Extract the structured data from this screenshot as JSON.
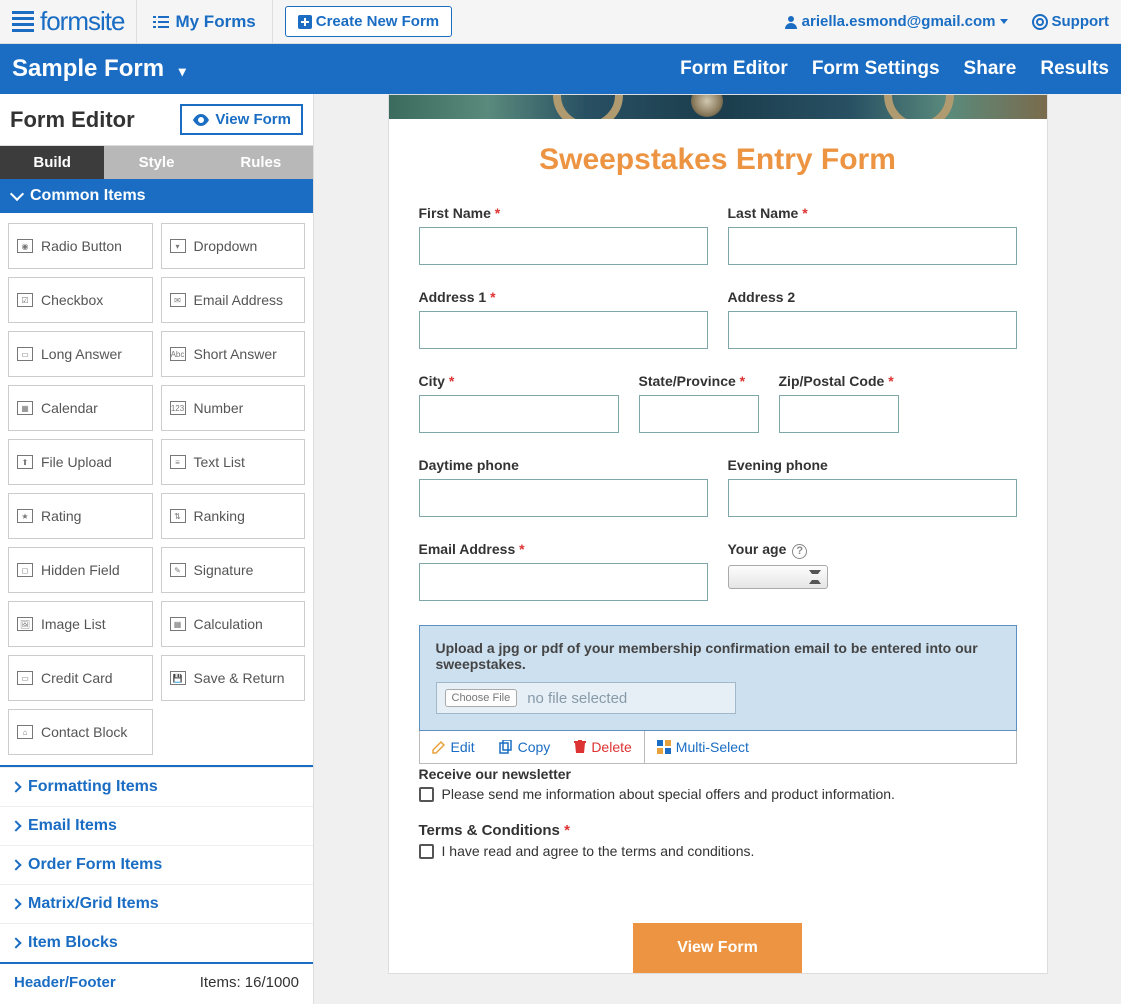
{
  "brand": "formsite",
  "topnav": {
    "my_forms": "My Forms",
    "create": "Create New Form",
    "user": "ariella.esmond@gmail.com",
    "support": "Support"
  },
  "bluebar": {
    "form_name": "Sample Form",
    "tabs": [
      "Form Editor",
      "Form Settings",
      "Share",
      "Results"
    ]
  },
  "sidebar": {
    "title": "Form Editor",
    "view_form": "View Form",
    "bsr": {
      "build": "Build",
      "style": "Style",
      "rules": "Rules"
    },
    "section": "Common Items",
    "items": [
      "Radio Button",
      "Dropdown",
      "Checkbox",
      "Email Address",
      "Long Answer",
      "Short Answer",
      "Calendar",
      "Number",
      "File Upload",
      "Text List",
      "Rating",
      "Ranking",
      "Hidden Field",
      "Signature",
      "Image List",
      "Calculation",
      "Credit Card",
      "Save & Return",
      "Contact Block"
    ],
    "item_icons": [
      "◉",
      "▾",
      "☑",
      "✉",
      "▭",
      "Abc",
      "▦",
      "123",
      "⬆",
      "≡",
      "★",
      "⇅",
      "◻",
      "✎",
      "🖼",
      "▦",
      "▭",
      "💾",
      "⌂"
    ],
    "cats": [
      "Formatting Items",
      "Email Items",
      "Order Form Items",
      "Matrix/Grid Items",
      "Item Blocks"
    ],
    "footer": {
      "hf": "Header/Footer",
      "count": "Items: 16/1000"
    }
  },
  "form": {
    "heading": "Sweepstakes Entry Form",
    "fields": {
      "first_name": "First Name",
      "last_name": "Last Name",
      "address1": "Address 1",
      "address2": "Address 2",
      "city": "City",
      "state": "State/Province",
      "zip": "Zip/Postal Code",
      "day_phone": "Daytime phone",
      "eve_phone": "Evening phone",
      "email": "Email Address",
      "age": "Your age"
    },
    "upload": {
      "label": "Upload a jpg or pdf of your membership confirmation email to be entered into our sweepstakes.",
      "choose": "Choose File",
      "nofile": "no file selected"
    },
    "toolbar": {
      "edit": "Edit",
      "copy": "Copy",
      "delete": "Delete",
      "multi": "Multi-Select"
    },
    "newsletter": {
      "hdr": "Receive our newsletter",
      "text": "Please send me information about special offers and product information."
    },
    "tc": {
      "label": "Terms & Conditions",
      "text": "I have read and agree to the terms and conditions."
    },
    "submit": "View Form"
  }
}
